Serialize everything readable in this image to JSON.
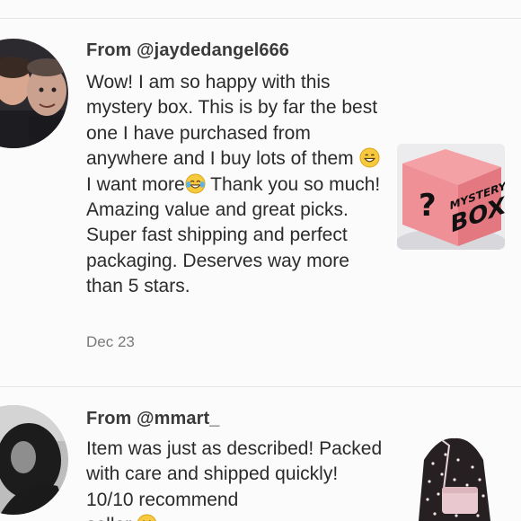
{
  "reviews": [
    {
      "from": "From @jaydedangel666",
      "text_part1": "Wow! I am so happy with this mystery box. This is by far the best one I have purchased from anywhere and I buy lots of them ",
      "text_part2": " I want more",
      "text_part3": " Thank you so much! Amazing value and great picks. Super fast shipping and perfect packaging. Deserves way more than 5 stars.",
      "emoji_1": "grinning-face",
      "emoji_2": "tears-of-joy-face",
      "date": "Dec 23",
      "product_label_line1": "MYSTERY",
      "product_label_line2": "BOX",
      "product_label_mark": "?"
    },
    {
      "from": "From @mmart_",
      "text_part1": "Item was just as described! Packed with care and shipped quickly! 10/10 recommend",
      "text_part2": "seller ",
      "emoji_1": "grinning-face"
    }
  ],
  "colors": {
    "background": "#fbfbfc",
    "box_pink": "#ef8f96",
    "text": "#2b2b2b",
    "muted": "#7a7a7a"
  }
}
